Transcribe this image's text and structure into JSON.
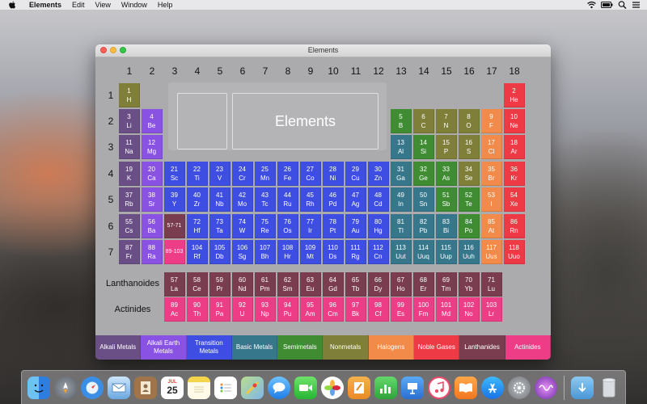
{
  "menubar": {
    "app": "Elements",
    "items": [
      "Edit",
      "View",
      "Window",
      "Help"
    ],
    "tray_icons": [
      "wifi-icon",
      "battery-icon",
      "search-icon",
      "list-icon"
    ]
  },
  "window": {
    "title": "Elements",
    "info_title": "Elements"
  },
  "groups": [
    "1",
    "2",
    "3",
    "4",
    "5",
    "6",
    "7",
    "8",
    "9",
    "10",
    "11",
    "12",
    "13",
    "14",
    "15",
    "16",
    "17",
    "18"
  ],
  "periods": [
    "1",
    "2",
    "3",
    "4",
    "5",
    "6",
    "7"
  ],
  "rows": {
    "lanthanoides": "Lanthanoides",
    "actinides": "Actinides"
  },
  "colors": {
    "alkali": "#6a4f86",
    "alkaline": "#8a52e2",
    "transition": "#3f4ee2",
    "basic": "#36778c",
    "semi": "#3f8c33",
    "nonmetal": "#7f7f3a",
    "halogen": "#f28a4a",
    "noble": "#ee3a44",
    "lanth": "#7a3d50",
    "actin": "#ec3d86",
    "ref_lanth": "#7a3d50",
    "ref_actin": "#ec3d86"
  },
  "elements": [
    {
      "num": "1",
      "sym": "H",
      "type": "nonmetal",
      "col": 1,
      "row": 1
    },
    {
      "num": "2",
      "sym": "He",
      "type": "noble",
      "col": 18,
      "row": 1
    },
    {
      "num": "3",
      "sym": "Li",
      "type": "alkali",
      "col": 1,
      "row": 2
    },
    {
      "num": "4",
      "sym": "Be",
      "type": "alkaline",
      "col": 2,
      "row": 2
    },
    {
      "num": "5",
      "sym": "B",
      "type": "semi",
      "col": 13,
      "row": 2
    },
    {
      "num": "6",
      "sym": "C",
      "type": "nonmetal",
      "col": 14,
      "row": 2
    },
    {
      "num": "7",
      "sym": "N",
      "type": "nonmetal",
      "col": 15,
      "row": 2
    },
    {
      "num": "8",
      "sym": "O",
      "type": "nonmetal",
      "col": 16,
      "row": 2
    },
    {
      "num": "9",
      "sym": "F",
      "type": "halogen",
      "col": 17,
      "row": 2
    },
    {
      "num": "10",
      "sym": "Ne",
      "type": "noble",
      "col": 18,
      "row": 2
    },
    {
      "num": "11",
      "sym": "Na",
      "type": "alkali",
      "col": 1,
      "row": 3
    },
    {
      "num": "12",
      "sym": "Mg",
      "type": "alkaline",
      "col": 2,
      "row": 3
    },
    {
      "num": "13",
      "sym": "Al",
      "type": "basic",
      "col": 13,
      "row": 3
    },
    {
      "num": "14",
      "sym": "Si",
      "type": "semi",
      "col": 14,
      "row": 3
    },
    {
      "num": "15",
      "sym": "P",
      "type": "nonmetal",
      "col": 15,
      "row": 3
    },
    {
      "num": "16",
      "sym": "S",
      "type": "nonmetal",
      "col": 16,
      "row": 3
    },
    {
      "num": "17",
      "sym": "Cl",
      "type": "halogen",
      "col": 17,
      "row": 3
    },
    {
      "num": "18",
      "sym": "Ar",
      "type": "noble",
      "col": 18,
      "row": 3
    },
    {
      "num": "19",
      "sym": "K",
      "type": "alkali",
      "col": 1,
      "row": 4
    },
    {
      "num": "20",
      "sym": "Ca",
      "type": "alkaline",
      "col": 2,
      "row": 4
    },
    {
      "num": "21",
      "sym": "Sc",
      "type": "transition",
      "col": 3,
      "row": 4
    },
    {
      "num": "22",
      "sym": "Ti",
      "type": "transition",
      "col": 4,
      "row": 4
    },
    {
      "num": "23",
      "sym": "V",
      "type": "transition",
      "col": 5,
      "row": 4
    },
    {
      "num": "24",
      "sym": "Cr",
      "type": "transition",
      "col": 6,
      "row": 4
    },
    {
      "num": "25",
      "sym": "Mn",
      "type": "transition",
      "col": 7,
      "row": 4
    },
    {
      "num": "26",
      "sym": "Fe",
      "type": "transition",
      "col": 8,
      "row": 4
    },
    {
      "num": "27",
      "sym": "Co",
      "type": "transition",
      "col": 9,
      "row": 4
    },
    {
      "num": "28",
      "sym": "Ni",
      "type": "transition",
      "col": 10,
      "row": 4
    },
    {
      "num": "29",
      "sym": "Cu",
      "type": "transition",
      "col": 11,
      "row": 4
    },
    {
      "num": "30",
      "sym": "Zn",
      "type": "transition",
      "col": 12,
      "row": 4
    },
    {
      "num": "31",
      "sym": "Ga",
      "type": "basic",
      "col": 13,
      "row": 4
    },
    {
      "num": "32",
      "sym": "Ge",
      "type": "semi",
      "col": 14,
      "row": 4
    },
    {
      "num": "33",
      "sym": "As",
      "type": "semi",
      "col": 15,
      "row": 4
    },
    {
      "num": "34",
      "sym": "Se",
      "type": "nonmetal",
      "col": 16,
      "row": 4
    },
    {
      "num": "35",
      "sym": "Br",
      "type": "halogen",
      "col": 17,
      "row": 4
    },
    {
      "num": "36",
      "sym": "Kr",
      "type": "noble",
      "col": 18,
      "row": 4
    },
    {
      "num": "37",
      "sym": "Rb",
      "type": "alkali",
      "col": 1,
      "row": 5
    },
    {
      "num": "38",
      "sym": "Sr",
      "type": "alkaline",
      "col": 2,
      "row": 5
    },
    {
      "num": "39",
      "sym": "Y",
      "type": "transition",
      "col": 3,
      "row": 5
    },
    {
      "num": "40",
      "sym": "Zr",
      "type": "transition",
      "col": 4,
      "row": 5
    },
    {
      "num": "41",
      "sym": "Nb",
      "type": "transition",
      "col": 5,
      "row": 5
    },
    {
      "num": "42",
      "sym": "Mo",
      "type": "transition",
      "col": 6,
      "row": 5
    },
    {
      "num": "43",
      "sym": "Tc",
      "type": "transition",
      "col": 7,
      "row": 5
    },
    {
      "num": "44",
      "sym": "Ru",
      "type": "transition",
      "col": 8,
      "row": 5
    },
    {
      "num": "45",
      "sym": "Rh",
      "type": "transition",
      "col": 9,
      "row": 5
    },
    {
      "num": "46",
      "sym": "Pd",
      "type": "transition",
      "col": 10,
      "row": 5
    },
    {
      "num": "47",
      "sym": "Ag",
      "type": "transition",
      "col": 11,
      "row": 5
    },
    {
      "num": "48",
      "sym": "Cd",
      "type": "transition",
      "col": 12,
      "row": 5
    },
    {
      "num": "49",
      "sym": "In",
      "type": "basic",
      "col": 13,
      "row": 5
    },
    {
      "num": "50",
      "sym": "Sn",
      "type": "basic",
      "col": 14,
      "row": 5
    },
    {
      "num": "51",
      "sym": "Sb",
      "type": "semi",
      "col": 15,
      "row": 5
    },
    {
      "num": "52",
      "sym": "Te",
      "type": "semi",
      "col": 16,
      "row": 5
    },
    {
      "num": "53",
      "sym": "I",
      "type": "halogen",
      "col": 17,
      "row": 5
    },
    {
      "num": "54",
      "sym": "Xe",
      "type": "noble",
      "col": 18,
      "row": 5
    },
    {
      "num": "55",
      "sym": "Cs",
      "type": "alkali",
      "col": 1,
      "row": 6
    },
    {
      "num": "56",
      "sym": "Ba",
      "type": "alkaline",
      "col": 2,
      "row": 6
    },
    {
      "num": "72",
      "sym": "Hf",
      "type": "transition",
      "col": 4,
      "row": 6
    },
    {
      "num": "73",
      "sym": "Ta",
      "type": "transition",
      "col": 5,
      "row": 6
    },
    {
      "num": "74",
      "sym": "W",
      "type": "transition",
      "col": 6,
      "row": 6
    },
    {
      "num": "75",
      "sym": "Re",
      "type": "transition",
      "col": 7,
      "row": 6
    },
    {
      "num": "76",
      "sym": "Os",
      "type": "transition",
      "col": 8,
      "row": 6
    },
    {
      "num": "77",
      "sym": "Ir",
      "type": "transition",
      "col": 9,
      "row": 6
    },
    {
      "num": "78",
      "sym": "Pt",
      "type": "transition",
      "col": 10,
      "row": 6
    },
    {
      "num": "79",
      "sym": "Au",
      "type": "transition",
      "col": 11,
      "row": 6
    },
    {
      "num": "80",
      "sym": "Hg",
      "type": "transition",
      "col": 12,
      "row": 6
    },
    {
      "num": "81",
      "sym": "Tl",
      "type": "basic",
      "col": 13,
      "row": 6
    },
    {
      "num": "82",
      "sym": "Pb",
      "type": "basic",
      "col": 14,
      "row": 6
    },
    {
      "num": "83",
      "sym": "Bi",
      "type": "basic",
      "col": 15,
      "row": 6
    },
    {
      "num": "84",
      "sym": "Po",
      "type": "semi",
      "col": 16,
      "row": 6
    },
    {
      "num": "85",
      "sym": "At",
      "type": "halogen",
      "col": 17,
      "row": 6
    },
    {
      "num": "86",
      "sym": "Rn",
      "type": "noble",
      "col": 18,
      "row": 6
    },
    {
      "num": "87",
      "sym": "Fr",
      "type": "alkali",
      "col": 1,
      "row": 7
    },
    {
      "num": "88",
      "sym": "Ra",
      "type": "alkaline",
      "col": 2,
      "row": 7
    },
    {
      "num": "104",
      "sym": "Rf",
      "type": "transition",
      "col": 4,
      "row": 7
    },
    {
      "num": "105",
      "sym": "Db",
      "type": "transition",
      "col": 5,
      "row": 7
    },
    {
      "num": "106",
      "sym": "Sg",
      "type": "transition",
      "col": 6,
      "row": 7
    },
    {
      "num": "107",
      "sym": "Bh",
      "type": "transition",
      "col": 7,
      "row": 7
    },
    {
      "num": "108",
      "sym": "Hr",
      "type": "transition",
      "col": 8,
      "row": 7
    },
    {
      "num": "109",
      "sym": "Mt",
      "type": "transition",
      "col": 9,
      "row": 7
    },
    {
      "num": "110",
      "sym": "Ds",
      "type": "transition",
      "col": 10,
      "row": 7
    },
    {
      "num": "111",
      "sym": "Rg",
      "type": "transition",
      "col": 11,
      "row": 7
    },
    {
      "num": "112",
      "sym": "Cn",
      "type": "transition",
      "col": 12,
      "row": 7
    },
    {
      "num": "113",
      "sym": "Uut",
      "type": "basic",
      "col": 13,
      "row": 7
    },
    {
      "num": "114",
      "sym": "Uuq",
      "type": "basic",
      "col": 14,
      "row": 7
    },
    {
      "num": "115",
      "sym": "Uup",
      "type": "basic",
      "col": 15,
      "row": 7
    },
    {
      "num": "116",
      "sym": "Uuh",
      "type": "basic",
      "col": 16,
      "row": 7
    },
    {
      "num": "117",
      "sym": "Uus",
      "type": "halogen",
      "col": 17,
      "row": 7
    },
    {
      "num": "118",
      "sym": "Uuo",
      "type": "noble",
      "col": 18,
      "row": 7
    },
    {
      "num": "57",
      "sym": "La",
      "type": "lanth",
      "col": 3,
      "row": 8
    },
    {
      "num": "58",
      "sym": "Ce",
      "type": "lanth",
      "col": 4,
      "row": 8
    },
    {
      "num": "59",
      "sym": "Pr",
      "type": "lanth",
      "col": 5,
      "row": 8
    },
    {
      "num": "60",
      "sym": "Nd",
      "type": "lanth",
      "col": 6,
      "row": 8
    },
    {
      "num": "61",
      "sym": "Pm",
      "type": "lanth",
      "col": 7,
      "row": 8
    },
    {
      "num": "62",
      "sym": "Sm",
      "type": "lanth",
      "col": 8,
      "row": 8
    },
    {
      "num": "63",
      "sym": "Eu",
      "type": "lanth",
      "col": 9,
      "row": 8
    },
    {
      "num": "64",
      "sym": "Gd",
      "type": "lanth",
      "col": 10,
      "row": 8
    },
    {
      "num": "65",
      "sym": "Tb",
      "type": "lanth",
      "col": 11,
      "row": 8
    },
    {
      "num": "66",
      "sym": "Dy",
      "type": "lanth",
      "col": 12,
      "row": 8
    },
    {
      "num": "67",
      "sym": "Ho",
      "type": "lanth",
      "col": 13,
      "row": 8
    },
    {
      "num": "68",
      "sym": "Er",
      "type": "lanth",
      "col": 14,
      "row": 8
    },
    {
      "num": "69",
      "sym": "Tm",
      "type": "lanth",
      "col": 15,
      "row": 8
    },
    {
      "num": "70",
      "sym": "Yb",
      "type": "lanth",
      "col": 16,
      "row": 8
    },
    {
      "num": "71",
      "sym": "Lu",
      "type": "lanth",
      "col": 17,
      "row": 8
    },
    {
      "num": "89",
      "sym": "Ac",
      "type": "actin",
      "col": 3,
      "row": 9
    },
    {
      "num": "90",
      "sym": "Th",
      "type": "actin",
      "col": 4,
      "row": 9
    },
    {
      "num": "91",
      "sym": "Pa",
      "type": "actin",
      "col": 5,
      "row": 9
    },
    {
      "num": "92",
      "sym": "U",
      "type": "actin",
      "col": 6,
      "row": 9
    },
    {
      "num": "93",
      "sym": "Np",
      "type": "actin",
      "col": 7,
      "row": 9
    },
    {
      "num": "94",
      "sym": "Pu",
      "type": "actin",
      "col": 8,
      "row": 9
    },
    {
      "num": "95",
      "sym": "Am",
      "type": "actin",
      "col": 9,
      "row": 9
    },
    {
      "num": "96",
      "sym": "Cm",
      "type": "actin",
      "col": 10,
      "row": 9
    },
    {
      "num": "97",
      "sym": "Bk",
      "type": "actin",
      "col": 11,
      "row": 9
    },
    {
      "num": "98",
      "sym": "Cf",
      "type": "actin",
      "col": 12,
      "row": 9
    },
    {
      "num": "99",
      "sym": "Es",
      "type": "actin",
      "col": 13,
      "row": 9
    },
    {
      "num": "100",
      "sym": "Fm",
      "type": "actin",
      "col": 14,
      "row": 9
    },
    {
      "num": "101",
      "sym": "Md",
      "type": "actin",
      "col": 15,
      "row": 9
    },
    {
      "num": "102",
      "sym": "No",
      "type": "actin",
      "col": 16,
      "row": 9
    },
    {
      "num": "103",
      "sym": "Lr",
      "type": "actin",
      "col": 17,
      "row": 9
    }
  ],
  "references": [
    {
      "label": "57-71",
      "type": "ref_lanth",
      "col": 3,
      "row": 6
    },
    {
      "label": "89-103",
      "type": "ref_actin",
      "col": 3,
      "row": 7
    }
  ],
  "legend": [
    {
      "label": "Alkali Metals",
      "type": "alkali"
    },
    {
      "label": "Alkali Earth Metals",
      "type": "alkaline"
    },
    {
      "label": "Transition Metals",
      "type": "transition"
    },
    {
      "label": "Basic Metals",
      "type": "basic"
    },
    {
      "label": "Semimetals",
      "type": "semi"
    },
    {
      "label": "Nonmetals",
      "type": "nonmetal"
    },
    {
      "label": "Halogens",
      "type": "halogen"
    },
    {
      "label": "Noble Gases",
      "type": "noble"
    },
    {
      "label": "Lanthanides",
      "type": "lanth"
    },
    {
      "label": "Actinides",
      "type": "actin"
    }
  ],
  "dock": {
    "calendar_month": "JUL",
    "calendar_day": "25",
    "apps": [
      "finder-icon",
      "launchpad-icon",
      "safari-icon",
      "mail-icon",
      "contacts-icon",
      "calendar-icon",
      "notes-icon",
      "reminders-icon",
      "maps-icon",
      "messages-icon",
      "facetime-icon",
      "photos-icon",
      "pages-icon",
      "numbers-icon",
      "keynote-icon",
      "itunes-icon",
      "ibooks-icon",
      "app-store-icon",
      "system-preferences-icon",
      "siri-icon",
      "downloads-icon",
      "trash-icon"
    ]
  }
}
